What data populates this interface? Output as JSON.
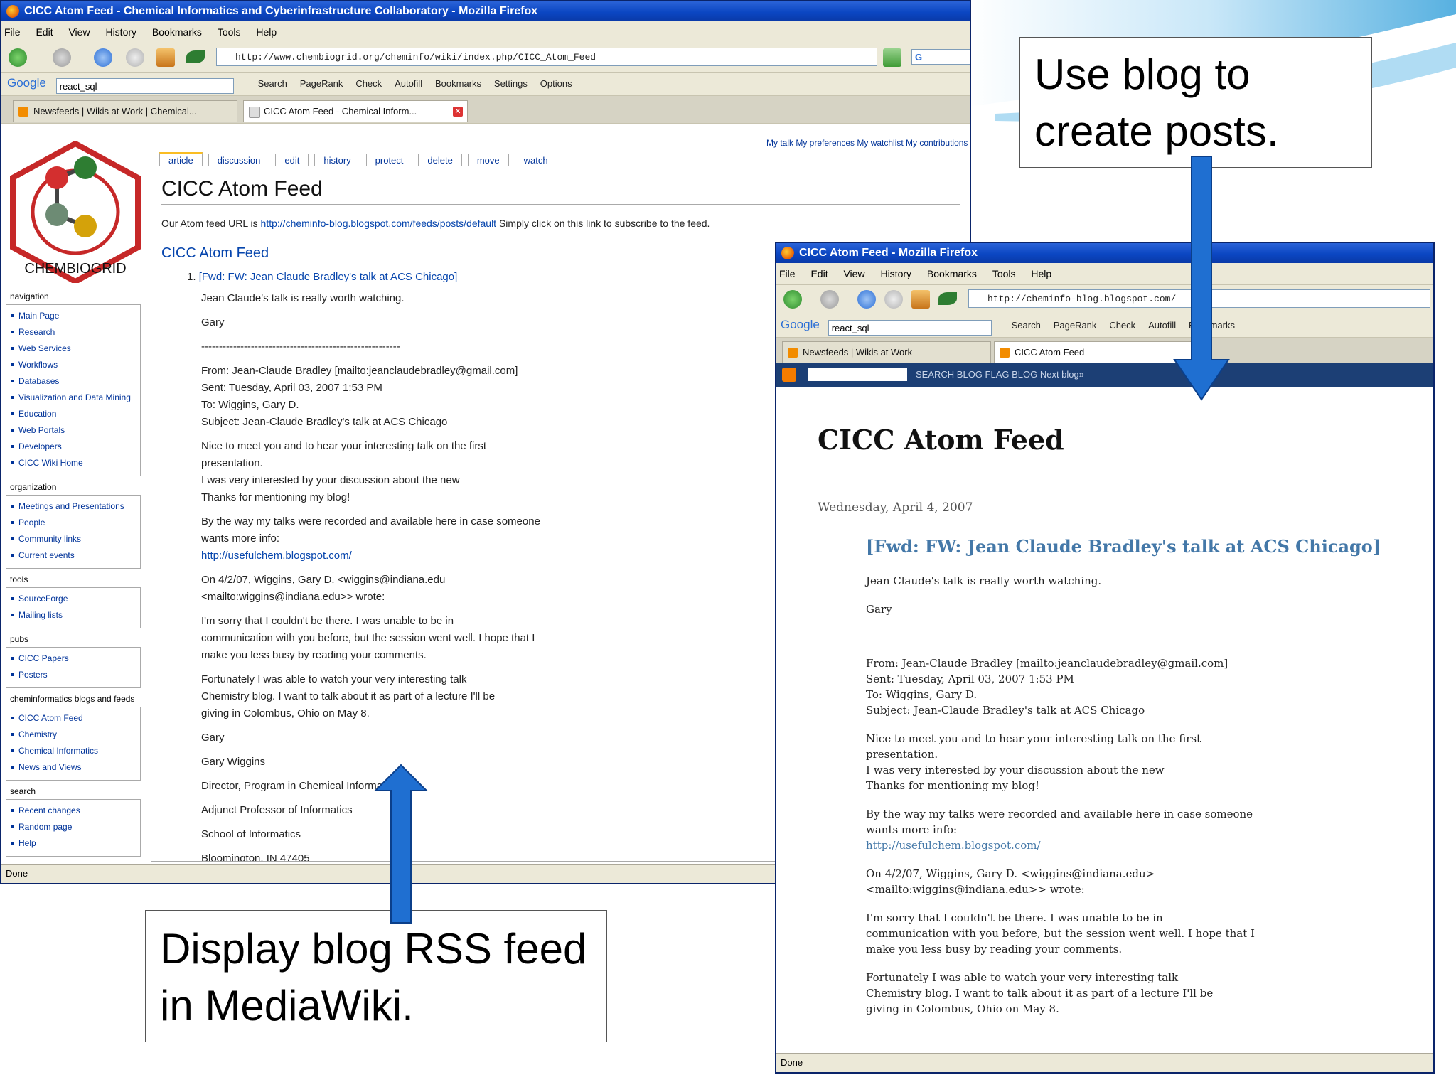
{
  "colors": {
    "xp_titlebar": "#0b46c2",
    "arrow_blue": "#1f6fd1",
    "blogger_nav": "#1c3f75",
    "blog_post_link": "#4478a8",
    "wiki_link": "#0645ad"
  },
  "wiki_window": {
    "title": "CICC Atom Feed - Chemical Informatics and Cyberinfrastructure Collaboratory - Mozilla Firefox",
    "menu": [
      "File",
      "Edit",
      "View",
      "History",
      "Bookmarks",
      "Tools",
      "Help"
    ],
    "url": "http://www.chembiogrid.org/cheminfo/wiki/index.php/CICC_Atom_Feed",
    "google_search_value": "react_sql",
    "toolbar_items": [
      "Search",
      "PageRank",
      "Check",
      "Autofill",
      "Bookmarks",
      "Settings",
      "Options"
    ],
    "tabs": [
      {
        "label": "Newsfeeds | Wikis at Work | Chemical..."
      },
      {
        "label": "CICC Atom Feed - Chemical Inform..."
      }
    ],
    "user_links": "My talk  My preferences  My watchlist  My contributions  Log out",
    "logo_text": "CHEMBIOGRID",
    "page_tabs": [
      "article",
      "discussion",
      "edit",
      "history",
      "protect",
      "delete",
      "move",
      "watch"
    ],
    "page_title": "CICC Atom Feed",
    "feed_url_prefix": "Our Atom feed URL is ",
    "feed_url": "http://cheminfo-blog.blogspot.com/feeds/posts/default",
    "feed_url_suffix": " Simply click on this link to subscribe to the feed.",
    "feed_heading": "CICC Atom Feed",
    "post_title": "[Fwd: FW: Jean Claude Bradley's talk at ACS Chicago]",
    "post_lines": [
      "Jean Claude's talk is really worth watching.",
      "Gary",
      "--------------------------------------------------------",
      "From: Jean-Claude Bradley [mailto:jeanclaudebradley@gmail.com]",
      "Sent: Tuesday, April 03, 2007 1:53 PM",
      "To: Wiggins, Gary D.",
      "Subject: Jean-Claude Bradley's talk at ACS Chicago",
      "Nice to meet you and to hear your interesting talk on the first",
      "presentation.",
      "I was very interested by your discussion about the new",
      "Thanks for mentioning my blog!",
      "By the way my talks were recorded and available here in case someone",
      "wants more info:",
      "http://usefulchem.blogspot.com/",
      "On 4/2/07, Wiggins, Gary D. <wiggins@indiana.edu",
      "<mailto:wiggins@indiana.edu>> wrote:",
      "I'm sorry that I couldn't be there. I was unable to be in",
      "communication with you before, but the session went well. I hope that I",
      "make you less busy by reading your comments.",
      "Fortunately I was able to watch your very interesting talk",
      "Chemistry blog. I want to talk about it as part of a lecture I'll be",
      "giving in Colombus, Ohio on May 8.",
      "Gary",
      "Gary Wiggins",
      "Director, Program in Chemical Informatics",
      "Adjunct Professor of Informatics",
      "School of Informatics",
      "Bloomington, IN 47405"
    ],
    "sidebar": {
      "navigation": {
        "heading": "navigation",
        "items": [
          "Main Page",
          "Research",
          "Web Services",
          "Workflows",
          "Databases",
          "Visualization and Data Mining",
          "Education",
          "Web Portals",
          "Developers",
          "CICC Wiki Home"
        ]
      },
      "organization": {
        "heading": "organization",
        "items": [
          "Meetings and Presentations",
          "People",
          "Community links",
          "Current events"
        ]
      },
      "tools": {
        "heading": "tools",
        "items": [
          "SourceForge",
          "Mailing lists"
        ]
      },
      "pubs": {
        "heading": "pubs",
        "items": [
          "CICC Papers",
          "Posters"
        ]
      },
      "blogs": {
        "heading": "cheminformatics blogs and feeds",
        "items": [
          "CICC Atom Feed",
          "Chemistry",
          "Chemical Informatics",
          "News and Views"
        ]
      },
      "search": {
        "heading": "search",
        "items": [
          "Recent changes",
          "Random page",
          "Help"
        ]
      }
    },
    "status": "Done"
  },
  "blog_window": {
    "title": "CICC Atom Feed - Mozilla Firefox",
    "menu": [
      "File",
      "Edit",
      "View",
      "History",
      "Bookmarks",
      "Tools",
      "Help"
    ],
    "url": "http://cheminfo-blog.blogspot.com/",
    "google_search_value": "react_sql",
    "toolbar_items": [
      "Search",
      "PageRank",
      "Check",
      "Autofill",
      "Bookmarks"
    ],
    "tabs": [
      {
        "label": "Newsfeeds | Wikis at Work"
      },
      {
        "label": "CICC Atom Feed"
      }
    ],
    "nav_links": "SEARCH BLOG  FLAG BLOG  Next blog»",
    "blog_title": "CICC Atom Feed",
    "date": "Wednesday, April 4, 2007",
    "post_title": "[Fwd: FW: Jean Claude Bradley's talk at ACS Chicago]",
    "paragraphs": [
      [
        "Jean Claude's talk is really worth watching."
      ],
      [
        "Gary"
      ],
      [
        ""
      ],
      [
        "From: Jean-Claude Bradley [mailto:jeanclaudebradley@gmail.com]",
        "Sent: Tuesday, April 03, 2007 1:53 PM",
        "To: Wiggins, Gary D.",
        "Subject: Jean-Claude Bradley's talk at ACS Chicago"
      ],
      [
        "Nice to meet you and to hear your interesting talk on the first",
        "presentation.",
        "I was very interested by your discussion about the new",
        "Thanks for mentioning my blog!"
      ],
      [
        "By the way my talks were recorded and available here in case someone",
        "wants more info:",
        "http://usefulchem.blogspot.com/"
      ],
      [
        "On 4/2/07, Wiggins, Gary D. <wiggins@indiana.edu>",
        "<mailto:wiggins@indiana.edu>> wrote:"
      ],
      [
        "I'm sorry that I couldn't be there. I was unable to be in",
        "communication with you before, but the session went well. I hope that I",
        "make you less busy by reading your comments."
      ],
      [
        "Fortunately I was able to watch your very interesting talk",
        "Chemistry blog. I want to talk about it as part of a lecture I'll be",
        "giving in Colombus, Ohio on May 8."
      ]
    ],
    "status": "Done"
  },
  "callouts": {
    "top": "Use blog to create posts.",
    "bottom": "Display blog RSS feed in MediaWiki."
  }
}
